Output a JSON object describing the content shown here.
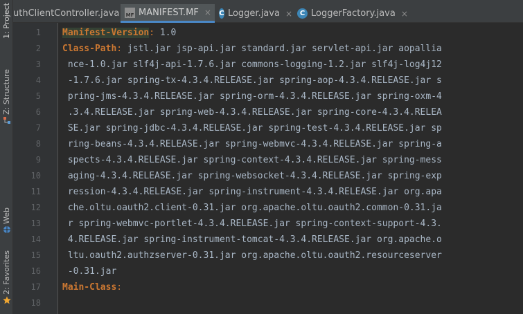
{
  "tool_strip": {
    "project_label": "1: Project",
    "structure_label": "Z: Structure",
    "web_label": "Web",
    "favorites_label": "2: Favorites"
  },
  "tabs": [
    {
      "label": "uthClientController.java",
      "icon": "class-icon",
      "active": false
    },
    {
      "label": "MANIFEST.MF",
      "icon": "manifest-file-icon",
      "active": true
    },
    {
      "label": "Logger.java",
      "icon": "class-icon",
      "active": false
    },
    {
      "label": "LoggerFactory.java",
      "icon": "class-icon",
      "active": false
    }
  ],
  "close_glyph": "×",
  "class_icon_letter": "C",
  "mf_icon_text": "MF",
  "line_numbers": [
    "1",
    "2",
    "3",
    "4",
    "5",
    "6",
    "7",
    "8",
    "9",
    "10",
    "11",
    "12",
    "13",
    "14",
    "15",
    "16",
    "17",
    "18"
  ],
  "code": {
    "l1_key": "Manifest-Version",
    "l1_sep": ":",
    "l1_val": " 1.0",
    "l2_key": "Class-Path",
    "l2_sep": ":",
    "l2_val": " jstl.jar jsp-api.jar standard.jar servlet-api.jar aopallia",
    "l3": " nce-1.0.jar slf4j-api-1.7.6.jar commons-logging-1.2.jar slf4j-log4j12",
    "l4": " -1.7.6.jar spring-tx-4.3.4.RELEASE.jar spring-aop-4.3.4.RELEASE.jar s",
    "l5": " pring-jms-4.3.4.RELEASE.jar spring-orm-4.3.4.RELEASE.jar spring-oxm-4",
    "l6": " .3.4.RELEASE.jar spring-web-4.3.4.RELEASE.jar spring-core-4.3.4.RELEA",
    "l7": " SE.jar spring-jdbc-4.3.4.RELEASE.jar spring-test-4.3.4.RELEASE.jar sp",
    "l8": " ring-beans-4.3.4.RELEASE.jar spring-webmvc-4.3.4.RELEASE.jar spring-a",
    "l9": " spects-4.3.4.RELEASE.jar spring-context-4.3.4.RELEASE.jar spring-mess",
    "l10": " aging-4.3.4.RELEASE.jar spring-websocket-4.3.4.RELEASE.jar spring-exp",
    "l11": " ression-4.3.4.RELEASE.jar spring-instrument-4.3.4.RELEASE.jar org.apa",
    "l12": " che.oltu.oauth2.client-0.31.jar org.apache.oltu.oauth2.common-0.31.ja",
    "l13": " r spring-webmvc-portlet-4.3.4.RELEASE.jar spring-context-support-4.3.",
    "l14": " 4.RELEASE.jar spring-instrument-tomcat-4.3.4.RELEASE.jar org.apache.o",
    "l15": " ltu.oauth2.authzserver-0.31.jar org.apache.oltu.oauth2.resourceserver",
    "l16": " -0.31.jar",
    "l17_key": "Main-Class",
    "l17_sep": ":",
    "l18": ""
  },
  "colors": {
    "keyword": "#cc7832",
    "text": "#a9b7c6",
    "background": "#2b2b2b",
    "accent": "#4a88c7"
  }
}
